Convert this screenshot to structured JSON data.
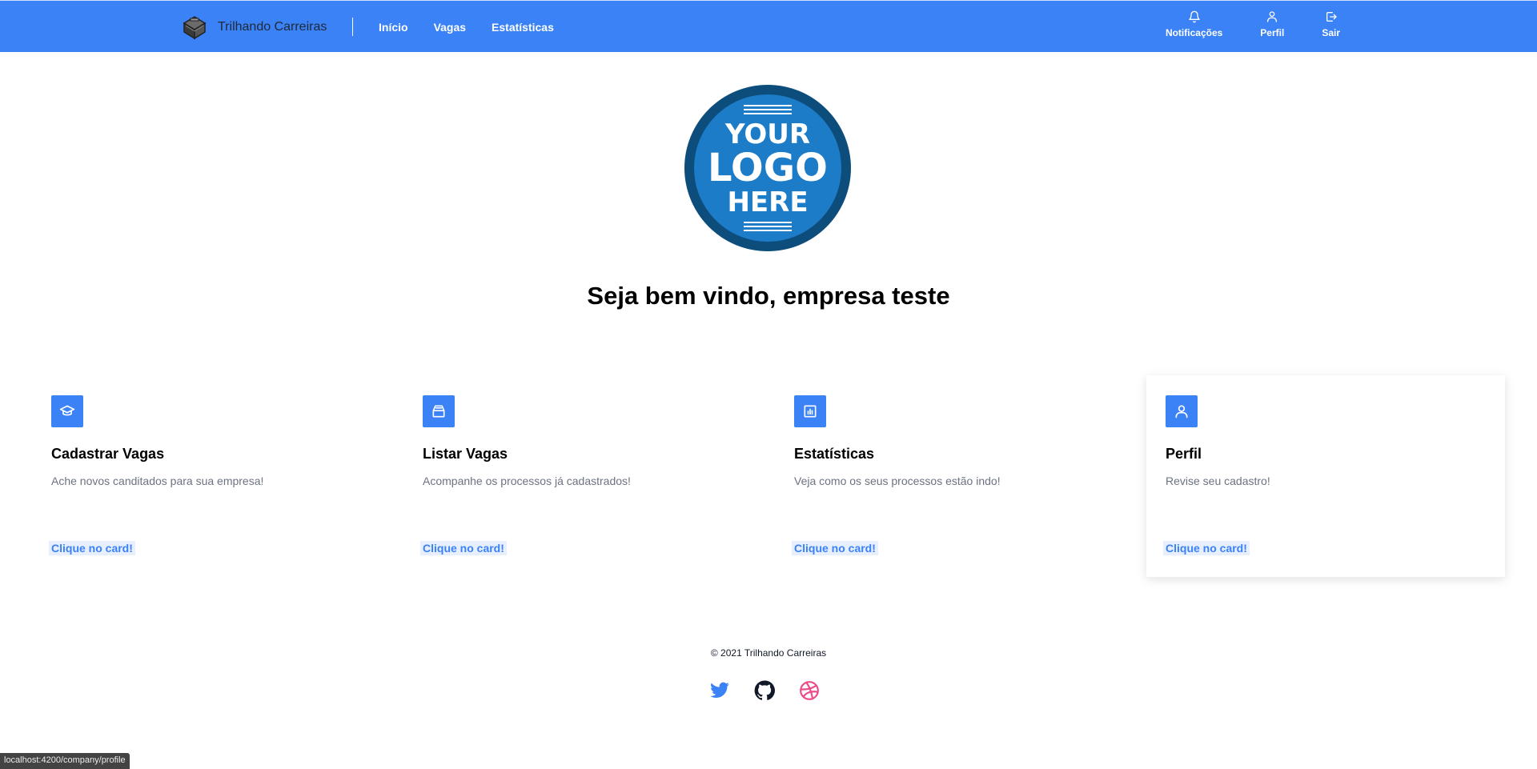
{
  "navbar": {
    "brand_name": "Trilhando Carreiras",
    "links": [
      {
        "label": "Início"
      },
      {
        "label": "Vagas"
      },
      {
        "label": "Estatísticas"
      }
    ],
    "actions": [
      {
        "label": "Notificações",
        "icon": "bell-icon"
      },
      {
        "label": "Perfil",
        "icon": "user-icon"
      },
      {
        "label": "Sair",
        "icon": "logout-icon"
      }
    ]
  },
  "company_logo": {
    "lines": [
      "YOUR",
      "LOGO",
      "HERE"
    ]
  },
  "welcome": "Seja bem vindo, empresa teste",
  "cards": [
    {
      "title": "Cadastrar Vagas",
      "description": "Ache novos canditados para sua empresa!",
      "link": "Clique no card!",
      "icon": "graduation-cap-icon"
    },
    {
      "title": "Listar Vagas",
      "description": "Acompanhe os processos já cadastrados!",
      "link": "Clique no card!",
      "icon": "archive-icon"
    },
    {
      "title": "Estatísticas",
      "description": "Veja como os seus processos estão indo!",
      "link": "Clique no card!",
      "icon": "bar-chart-icon"
    },
    {
      "title": "Perfil",
      "description": "Revise seu cadastro!",
      "link": "Clique no card!",
      "icon": "user-icon"
    }
  ],
  "footer": {
    "copyright": "© 2021 Trilhando Carreiras",
    "socials": [
      "twitter-icon",
      "github-icon",
      "dribbble-icon"
    ]
  },
  "status_bar": {
    "url": "localhost:4200/company/profile"
  },
  "colors": {
    "primary": "#3b82f6",
    "logo_blue": "#1c7cc8",
    "logo_ring": "#0d4d7c",
    "twitter": "#3b82f6",
    "github": "#111827",
    "dribbble": "#ea4c89"
  }
}
